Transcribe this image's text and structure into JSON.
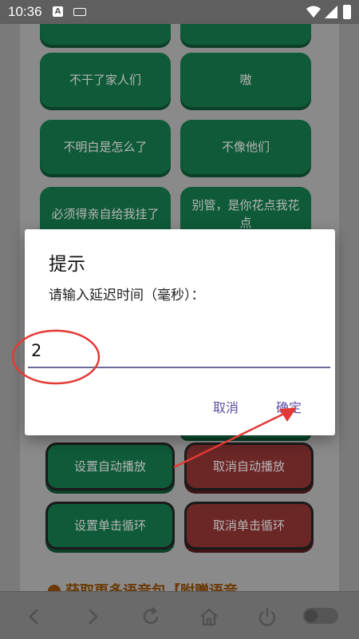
{
  "status_bar": {
    "time": "10:36",
    "notif_icon_letter": "A"
  },
  "tiles": [
    {
      "label": ""
    },
    {
      "label": ""
    },
    {
      "label": "不干了家人们"
    },
    {
      "label": "嗷"
    },
    {
      "label": "不明白是怎么了"
    },
    {
      "label": "不像他们"
    },
    {
      "label": "必须得亲自给我挂了"
    },
    {
      "label": "别管，是你花点我花点"
    },
    {
      "label": "设置自动播放"
    },
    {
      "label": "取消自动播放"
    },
    {
      "label": "设置单击循环"
    },
    {
      "label": "取消单击循环"
    }
  ],
  "promo": {
    "text": "获取更多语音包【附赠语音"
  },
  "dialog": {
    "title": "提示",
    "message": "请输入延迟时间（毫秒）：",
    "input_value": "2",
    "cancel_label": "取消",
    "ok_label": "确定"
  },
  "colors": {
    "accent": "#5a4fa8",
    "annotation": "#e53935",
    "tile_green": "#0f5a38",
    "tile_red": "#6b2626"
  },
  "bottom_nav": {
    "icons": [
      "back-icon",
      "forward-icon",
      "refresh-icon",
      "home-icon",
      "power-icon",
      "toggle-switch"
    ]
  }
}
